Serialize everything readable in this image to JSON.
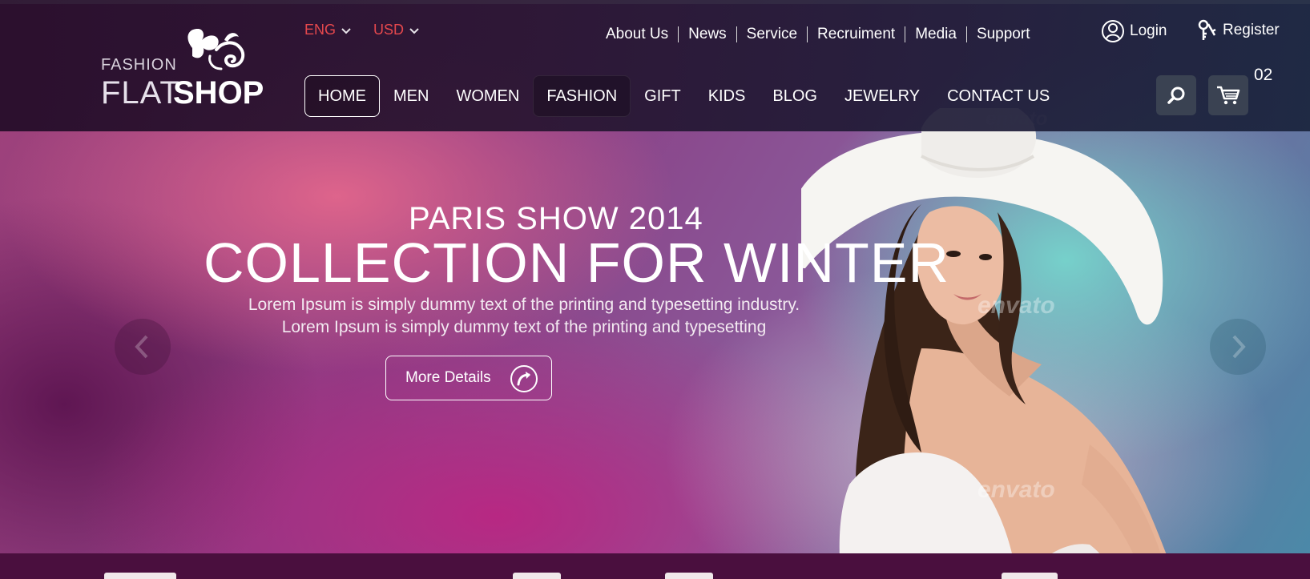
{
  "logo": {
    "small": "FASHION",
    "flat": "FLAT",
    "shop": "SHOP"
  },
  "selectors": {
    "language": "ENG",
    "currency": "USD"
  },
  "top_links": [
    "About Us",
    "News",
    "Service",
    "Recruiment",
    "Media",
    "Support"
  ],
  "account": {
    "login": "Login",
    "register": "Register"
  },
  "nav": [
    "HOME",
    "MEN",
    "WOMEN",
    "FASHION",
    "GIFT",
    "KIDS",
    "BLOG",
    "JEWELRY",
    "CONTACT US"
  ],
  "cart": {
    "count": "02"
  },
  "slide": {
    "subtitle": "PARIS SHOW 2014",
    "title": "COLLECTION FOR WINTER",
    "desc_line1": "Lorem Ipsum is simply dummy text of the printing and typesetting industry.",
    "desc_line2": "Lorem Ipsum is simply dummy text of the printing and typesetting",
    "button": "More Details"
  },
  "watermark": "envato",
  "colors": {
    "selector_red": "#e5484d",
    "header_dark": "#261430",
    "icon_button": "#3a4252"
  }
}
